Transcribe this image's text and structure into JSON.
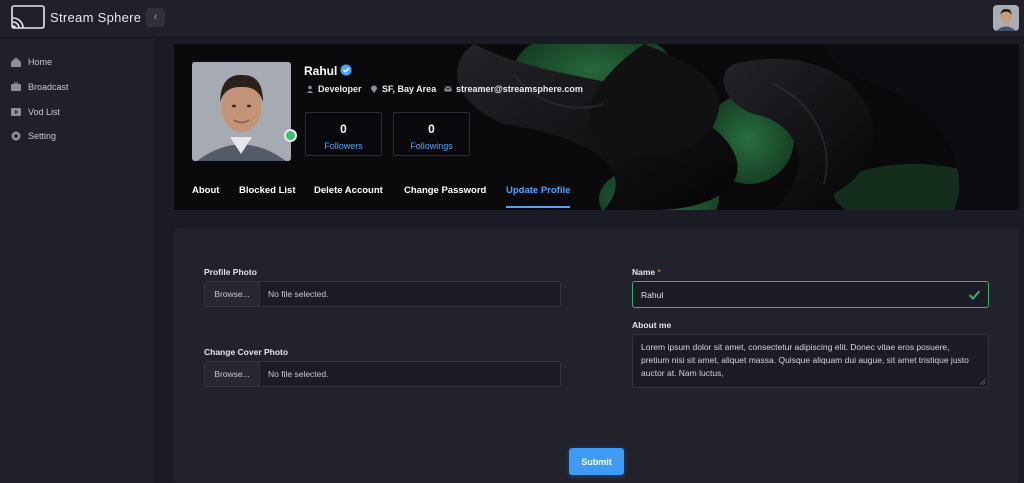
{
  "app": {
    "title": "Stream Sphere",
    "collapse_glyph": "‹"
  },
  "sidebar": {
    "items": [
      {
        "label": "Home",
        "icon": "home-icon"
      },
      {
        "label": "Broadcast",
        "icon": "broadcast-icon"
      },
      {
        "label": "Vod List",
        "icon": "video-list-icon"
      },
      {
        "label": "Setting",
        "icon": "gear-icon"
      }
    ]
  },
  "profile": {
    "name": "Rahul",
    "role": "Developer",
    "location": "SF, Bay Area",
    "email": "streamer@streamsphere.com",
    "followers_count": "0",
    "followers_label": "Followers",
    "followings_count": "0",
    "followings_label": "Followings"
  },
  "tabs": [
    {
      "label": "About"
    },
    {
      "label": "Blocked List"
    },
    {
      "label": "Delete Account"
    },
    {
      "label": "Change Password"
    },
    {
      "label": "Update Profile"
    }
  ],
  "active_tab": "Update Profile",
  "form": {
    "profile_photo_label": "Profile Photo",
    "cover_photo_label": "Change Cover Photo",
    "browse_label": "Browse...",
    "no_file_text": "No file selected.",
    "name_label": "Name",
    "required_mark": "*",
    "name_value": "Rahul",
    "about_label": "About me",
    "about_value": "Lorem ipsum dolor sit amet, consectetur adipiscing elit. Donec vitae eros posuere, pretium nisi sit amet, aliquet massa. Quisque aliquam dui augue, sit amet tristique justo auctor at. Nam luctus,",
    "submit_label": "Submit"
  },
  "colors": {
    "accent": "#4ba3ff",
    "submit": "#3d9bf5",
    "valid": "#3fae6a",
    "online": "#3fbf6a",
    "background": "#1b1b26",
    "panel": "#22222d"
  }
}
